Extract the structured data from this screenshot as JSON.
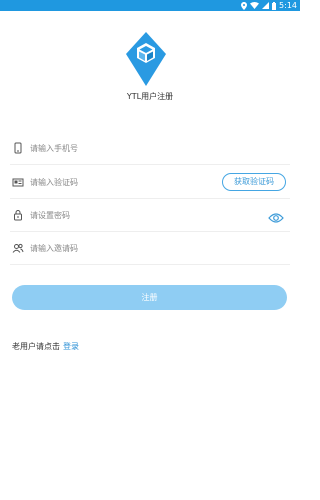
{
  "status_bar": {
    "time": "5:14",
    "color": "#1f98e0",
    "icons": [
      "location-icon",
      "wifi-icon",
      "signal-icon",
      "battery-icon"
    ]
  },
  "app": {
    "title": "YTL用户注册",
    "logo_icon": "diamond-cube-logo",
    "brand_color": "#2a9ae2"
  },
  "form": {
    "phone": {
      "placeholder": "请输入手机号",
      "value": "",
      "icon": "phone-icon"
    },
    "code": {
      "placeholder": "请输入验证码",
      "value": "",
      "icon": "id-card-icon",
      "get_code_label": "获取验证码"
    },
    "password": {
      "placeholder": "请设置密码",
      "value": "",
      "icon": "lock-icon",
      "toggle_icon": "eye-icon"
    },
    "invite": {
      "placeholder": "请输入邀请码",
      "value": "",
      "icon": "users-icon"
    }
  },
  "register_button": {
    "label": "注册",
    "color": "#8fcdf3"
  },
  "login_hint": {
    "text": "老用户请点击",
    "link_label": "登录"
  }
}
